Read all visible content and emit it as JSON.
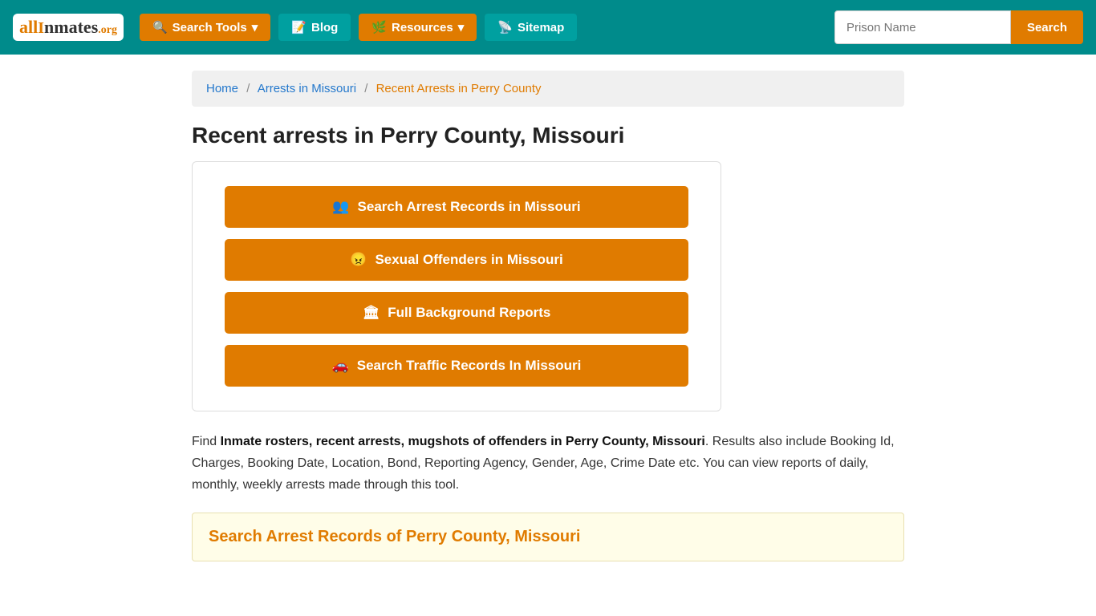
{
  "navbar": {
    "logo": "allInmates.org",
    "search_tools_label": "Search Tools",
    "blog_label": "Blog",
    "resources_label": "Resources",
    "sitemap_label": "Sitemap",
    "search_placeholder": "Prison Name",
    "search_btn_label": "Search"
  },
  "breadcrumb": {
    "home": "Home",
    "arrests": "Arrests in Missouri",
    "current": "Recent Arrests in Perry County"
  },
  "page": {
    "title": "Recent arrests in Perry County, Missouri",
    "buttons": [
      {
        "label": "Search Arrest Records in Missouri",
        "icon": "👥"
      },
      {
        "label": "Sexual Offenders in Missouri",
        "icon": "😠"
      },
      {
        "label": "Full Background Reports",
        "icon": "🏛"
      },
      {
        "label": "Search Traffic Records In Missouri",
        "icon": "🚗"
      }
    ],
    "description_prefix": "Find ",
    "description_bold": "Inmate rosters, recent arrests, mugshots of offenders in Perry County, Missouri",
    "description_suffix": ". Results also include Booking Id, Charges, Booking Date, Location, Bond, Reporting Agency, Gender, Age, Crime Date etc. You can view reports of daily, monthly, weekly arrests made through this tool.",
    "section_title": "Search Arrest Records of Perry County, Missouri"
  }
}
